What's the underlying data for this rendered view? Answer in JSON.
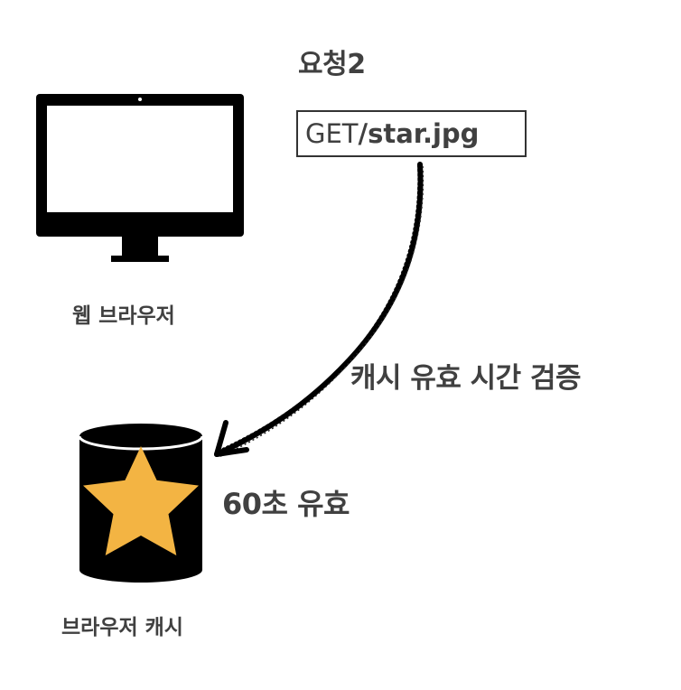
{
  "request": {
    "title": "요청2",
    "method": "GET ",
    "path": "/star.jpg"
  },
  "browser": {
    "label": "웹 브라우저",
    "icon": "monitor-icon"
  },
  "arrow": {
    "label": "캐시 유효 시간 검증"
  },
  "cache": {
    "ttl_label": "60초 유효",
    "label": "브라우저 캐시",
    "icon": "database-star-icon",
    "star_color": "#F3B443",
    "body_color": "#000000"
  }
}
